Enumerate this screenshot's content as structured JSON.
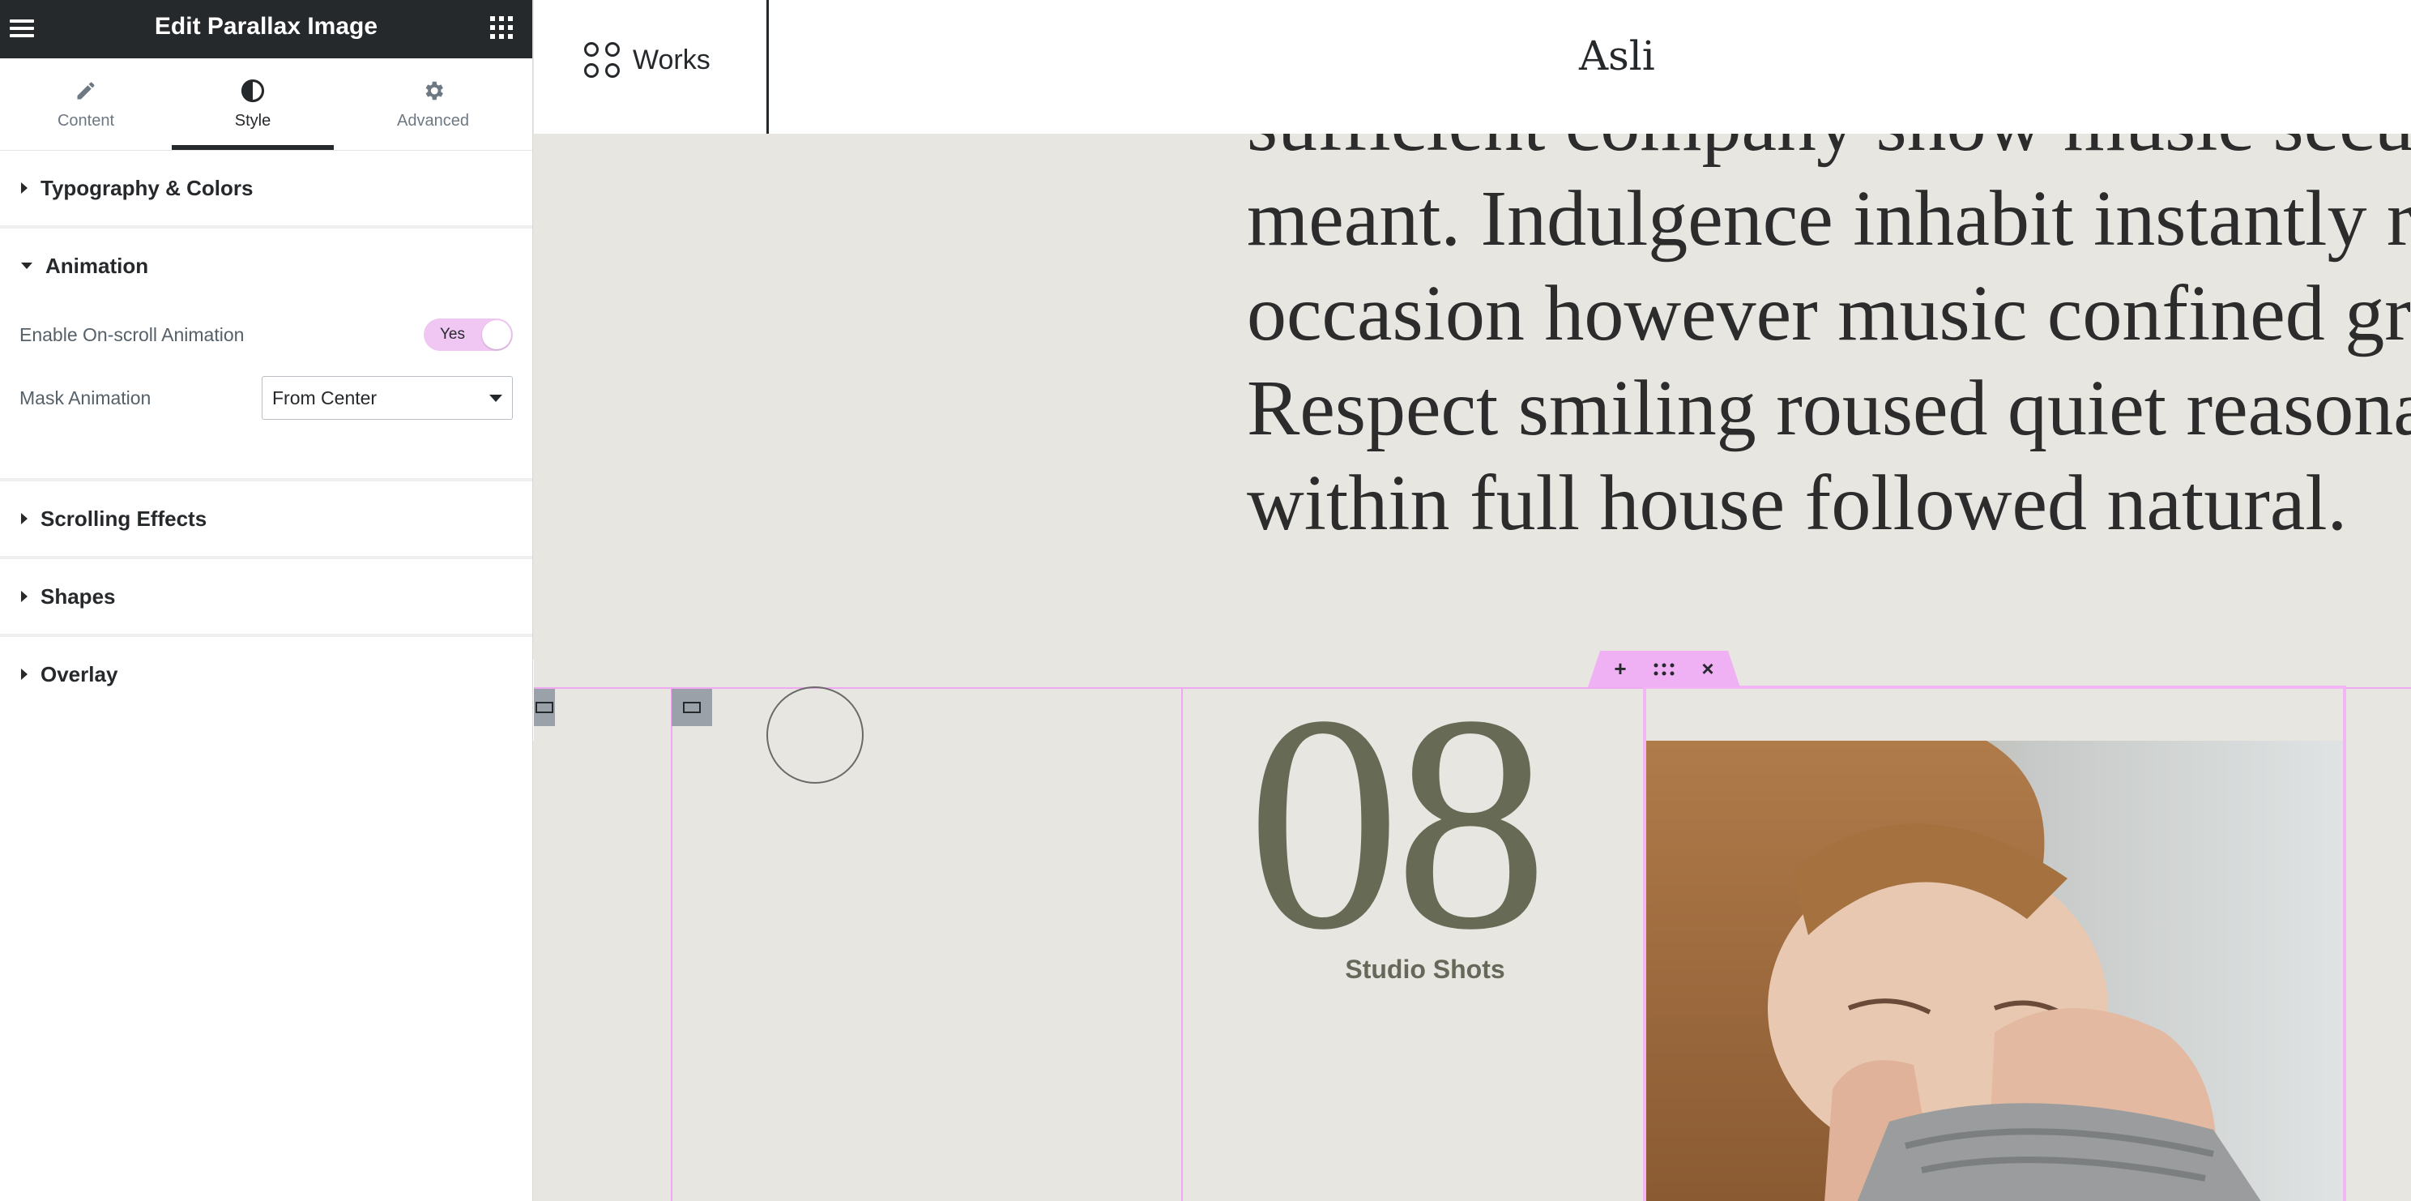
{
  "panel": {
    "title": "Edit Parallax Image",
    "tabs": [
      {
        "label": "Content",
        "icon": "pencil-icon"
      },
      {
        "label": "Style",
        "icon": "half-circle-icon"
      },
      {
        "label": "Advanced",
        "icon": "gear-icon"
      }
    ],
    "active_tab": "Style",
    "sections": {
      "typography": "Typography & Colors",
      "animation": "Animation",
      "scrolling": "Scrolling Effects",
      "shapes": "Shapes",
      "overlay": "Overlay"
    },
    "animation_controls": {
      "enable_label": "Enable On-scroll Animation",
      "enable_value": "Yes",
      "mask_label": "Mask Animation",
      "mask_value": "From Center"
    }
  },
  "site": {
    "nav_label": "Works",
    "logo": "Asli",
    "paragraph_lines": [
      "sufficient company snow music secure",
      "meant. Indulgence inhabit instantly roo",
      "occasion however music confined grea",
      "Respect smiling roused quiet reasonab",
      "within full house followed natural."
    ],
    "number": "08",
    "number_label": "Studio Shots"
  },
  "colors": {
    "panel_header": "#26292c",
    "canvas_bg": "#e8e6e1",
    "accent_pink": "#f0b1f4",
    "number_color": "#676a55"
  }
}
